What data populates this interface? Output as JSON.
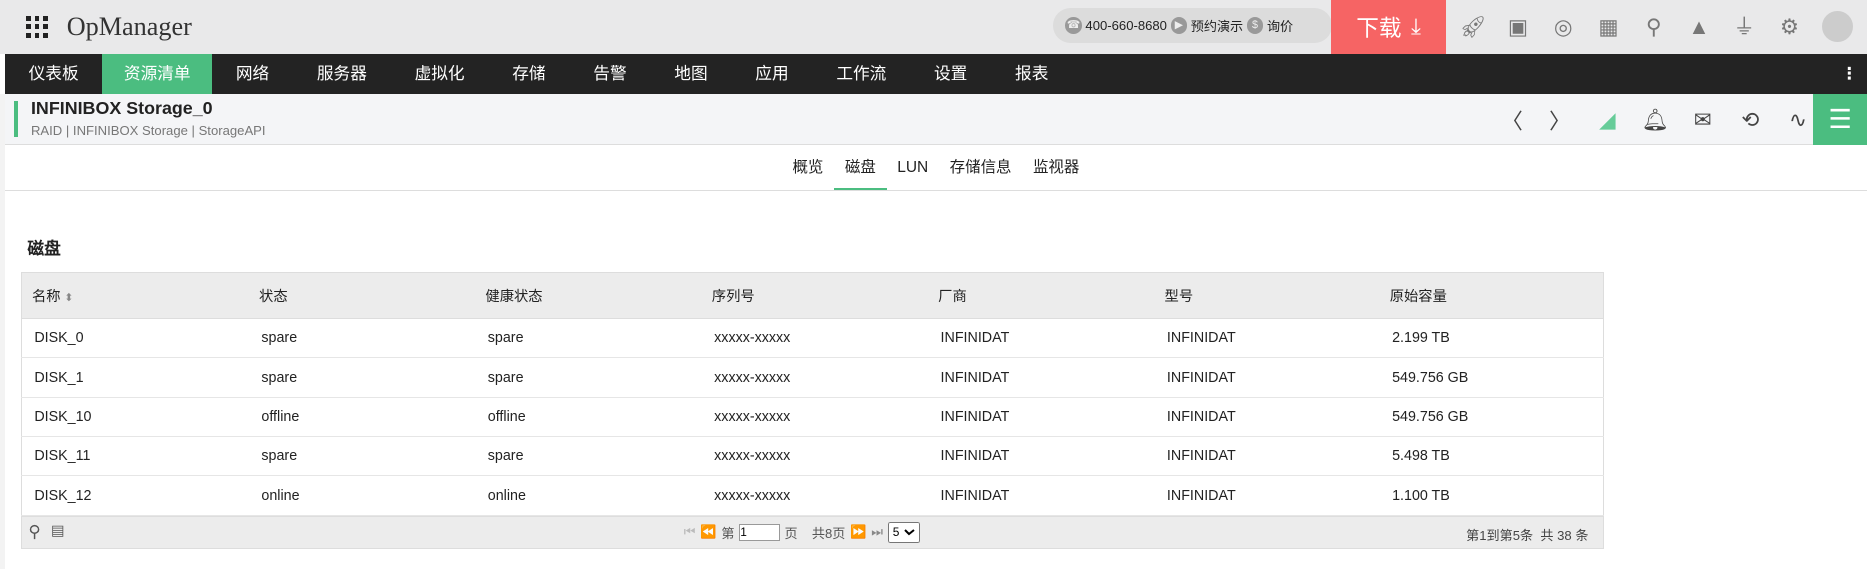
{
  "app": {
    "title": "OpManager",
    "phone": "400-660-8680",
    "demo": "预约演示",
    "price": "询价",
    "download": "下载"
  },
  "nav": [
    "仪表板",
    "资源清单",
    "网络",
    "服务器",
    "虚拟化",
    "存储",
    "告警",
    "地图",
    "应用",
    "工作流",
    "设置",
    "报表"
  ],
  "device": {
    "name": "INFINIBOX Storage_0",
    "crumb": "RAID | INFINIBOX Storage | StorageAPI"
  },
  "tabs": [
    "概览",
    "磁盘",
    "LUN",
    "存储信息",
    "监视器"
  ],
  "section": "磁盘",
  "table": {
    "headers": [
      "名称",
      "状态",
      "健康状态",
      "序列号",
      "厂商",
      "型号",
      "原始容量"
    ],
    "rows": [
      [
        "DISK_0",
        "spare",
        "spare",
        "xxxxx-xxxxx",
        "INFINIDAT",
        "INFINIDAT",
        "2.199 TB"
      ],
      [
        "DISK_1",
        "spare",
        "spare",
        "xxxxx-xxxxx",
        "INFINIDAT",
        "INFINIDAT",
        "549.756 GB"
      ],
      [
        "DISK_10",
        "offline",
        "offline",
        "xxxxx-xxxxx",
        "INFINIDAT",
        "INFINIDAT",
        "549.756 GB"
      ],
      [
        "DISK_11",
        "spare",
        "spare",
        "xxxxx-xxxxx",
        "INFINIDAT",
        "INFINIDAT",
        "5.498 TB"
      ],
      [
        "DISK_12",
        "online",
        "online",
        "xxxxx-xxxxx",
        "INFINIDAT",
        "INFINIDAT",
        "1.100 TB"
      ]
    ]
  },
  "pager": {
    "page_prefix": "第",
    "page": "1",
    "page_suffix": "页",
    "total_pages": "共8页",
    "page_size": "5",
    "range": "第1到第5条",
    "total": "共 38 条"
  }
}
